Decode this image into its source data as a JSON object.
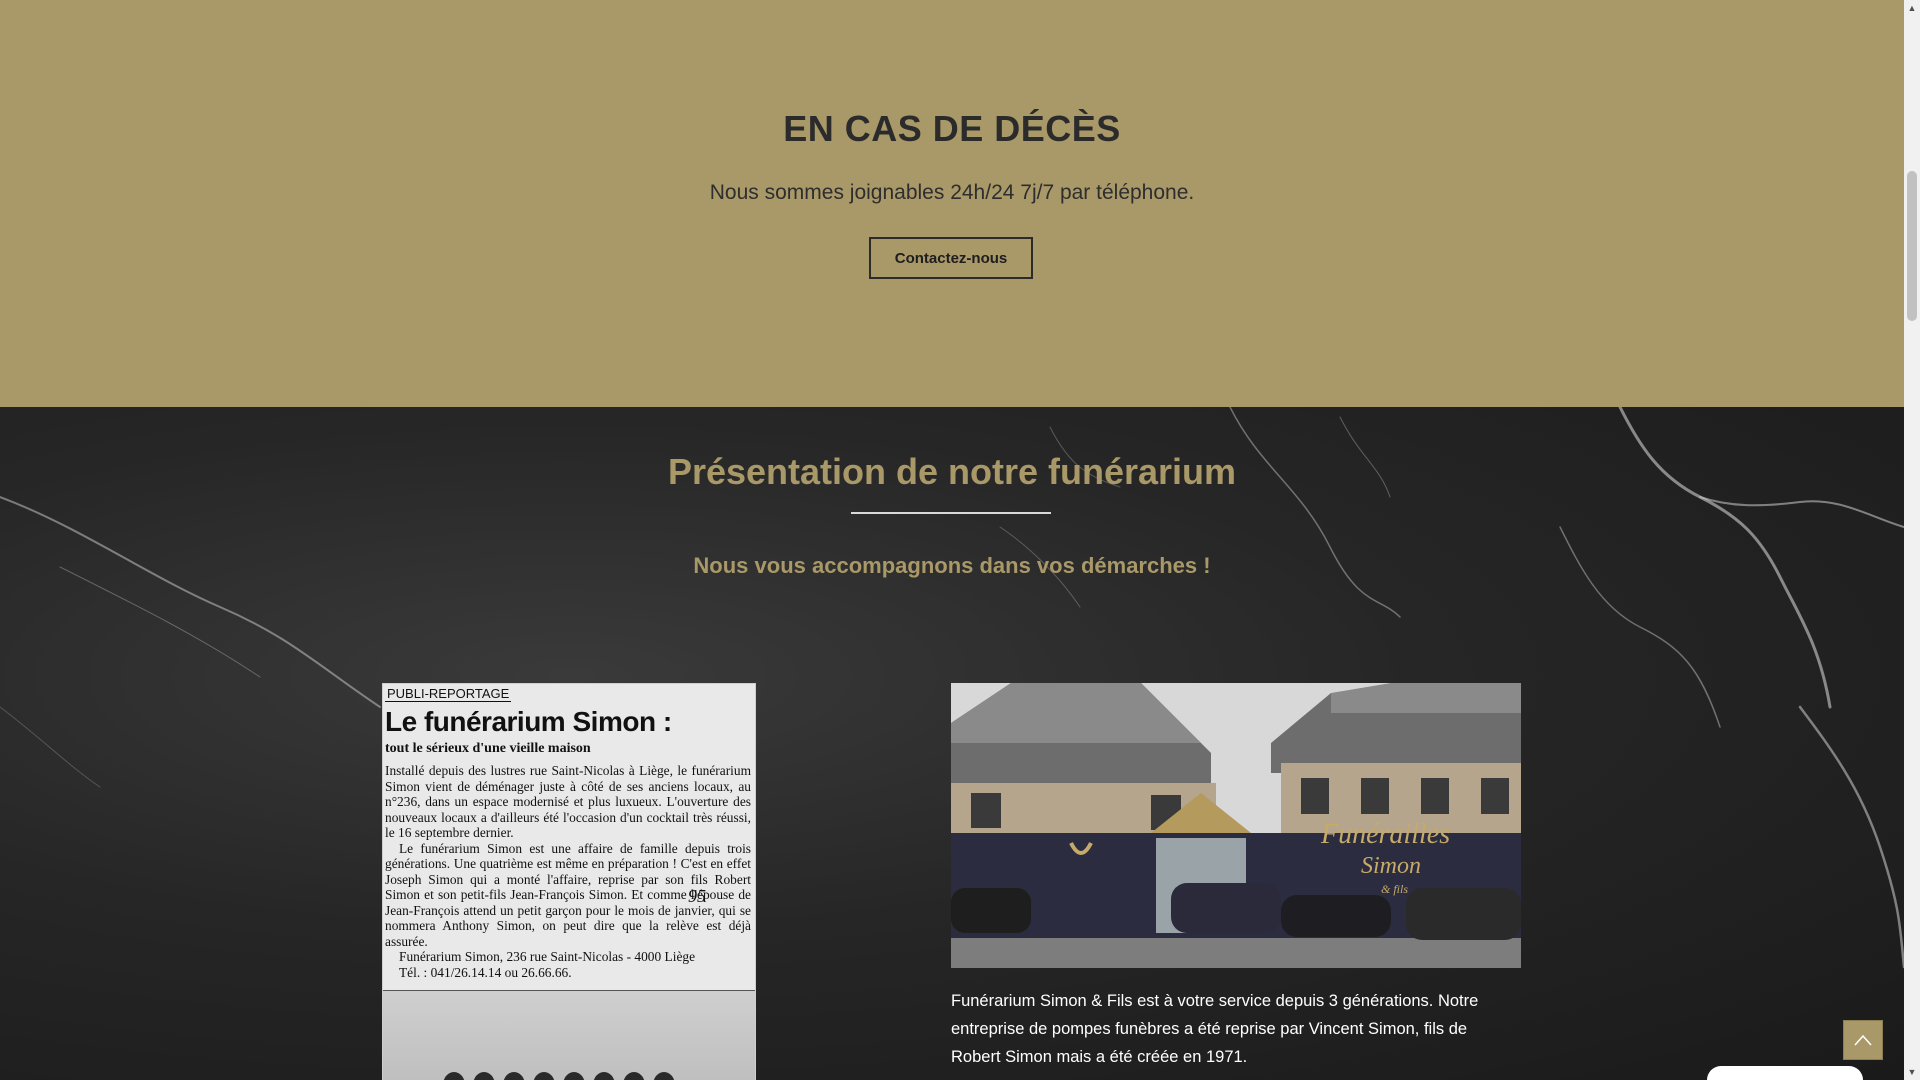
{
  "deces": {
    "title": "EN CAS DE DÉCÈS",
    "text": "Nous sommes joignables 24h/24 7j/7 par téléphone.",
    "button_label": "Contactez-nous"
  },
  "presentation": {
    "title": "Présentation de notre funérarium",
    "subtitle": "Nous vous accompagnons dans vos démarches !",
    "description": "Funérarium Simon & Fils est à votre service depuis 3 générations. Notre entreprise de pompes funèbres a été reprise par Vincent Simon, fils de Robert Simon mais a été créée en 1971."
  },
  "clipping": {
    "tag": "PUBLI-REPORTAGE",
    "headline": "Le funérarium Simon :",
    "kicker": "tout le sérieux d'une vieille maison",
    "paragraph1": "Installé depuis des lustres rue Saint-Nicolas à Liège, le funérarium Simon vient de déménager juste à côté de ses anciens locaux, au n°236, dans un espace modernisé et plus luxueux. L'ouverture des nouveaux locaux a d'ailleurs été l'occasion d'un cocktail très réussi, le 16 septembre dernier.",
    "handwritten": "95",
    "paragraph2": "Le funérarium Simon est une affaire de famille depuis trois générations. Une quatrième est même en préparation ! C'est en effet Joseph Simon qui a monté l'affaire, reprise par son fils Robert Simon et son petit-fils Jean-François Simon. Et comme l'épouse de Jean-François attend un petit garçon pour le mois de janvier, qui se nommera Anthony Simon, on peut dire que la relève est déjà assurée.",
    "address1": "Funérarium Simon, 236 rue Saint-Nicolas - 4000 Liège",
    "address2": "Tél. : 041/26.14.14 ou 26.66.66."
  },
  "building": {
    "sign_line1": "Funérailles",
    "sign_line2": "Simon",
    "sign_line3": "& fils"
  },
  "colors": {
    "gold": "#a99868",
    "dark_text": "#2b2b2b",
    "marble": "#262626"
  },
  "icons": {
    "back_to_top": "chevron-up-icon"
  }
}
